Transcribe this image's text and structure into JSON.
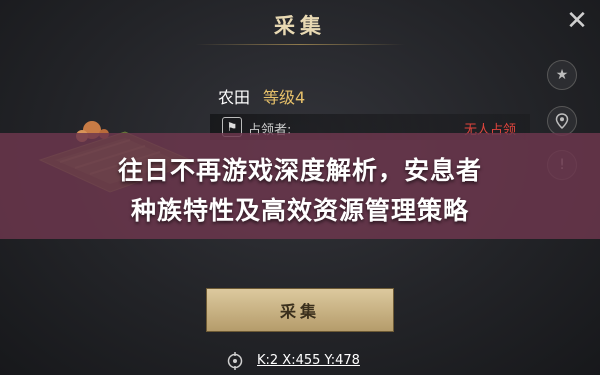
{
  "header": {
    "title": "采集"
  },
  "farm": {
    "name": "农田",
    "level": "等级4"
  },
  "occupier": {
    "label": "占领者:",
    "value": "无人占领"
  },
  "banner": {
    "line1": "往日不再游戏深度解析，安息者",
    "line2": "种族特性及高效资源管理策略"
  },
  "action": {
    "collect_label": "采集"
  },
  "location": {
    "coords": "K:2 X:455 Y:478"
  },
  "side_icons": [
    "star-icon",
    "location-pin-icon",
    "alert-icon"
  ],
  "colors": {
    "accent_gold": "#e6c06a",
    "occupied_red": "#e0443c",
    "banner": "#6c374d"
  }
}
